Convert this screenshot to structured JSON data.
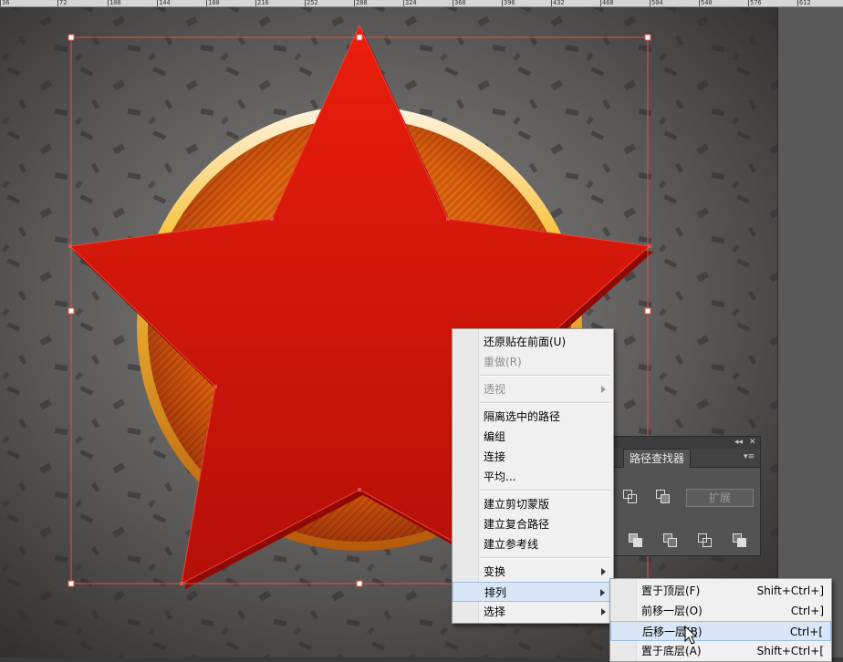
{
  "ruler": {
    "ticks": [
      "36",
      "72",
      "108",
      "144",
      "180",
      "216",
      "252",
      "288",
      "324",
      "360",
      "396",
      "432",
      "468",
      "504",
      "540",
      "576",
      "612"
    ]
  },
  "colors": {
    "canvas_bg": "#5a5a5a",
    "star_red": "#d81a0c",
    "selection": "#e0524a",
    "menu_bg": "#f0f0f0"
  },
  "context_menu": {
    "items": [
      {
        "label": "还原贴在前面(U)",
        "disabled": false
      },
      {
        "label": "重做(R)",
        "disabled": true
      },
      {
        "label": "透视",
        "disabled": true,
        "submenu": true
      },
      {
        "label": "隔离选中的路径"
      },
      {
        "label": "编组"
      },
      {
        "label": "连接"
      },
      {
        "label": "平均..."
      },
      {
        "label": "建立剪切蒙版"
      },
      {
        "label": "建立复合路径"
      },
      {
        "label": "建立参考线"
      },
      {
        "label": "变换",
        "submenu": true
      },
      {
        "label": "排列",
        "submenu": true,
        "active": true
      },
      {
        "label": "选择",
        "submenu": true
      }
    ]
  },
  "arrange_submenu": {
    "items": [
      {
        "label": "置于顶层(F)",
        "shortcut": "Shift+Ctrl+]"
      },
      {
        "label": "前移一层(O)",
        "shortcut": "Ctrl+]"
      },
      {
        "label": "后移一层(B)",
        "shortcut": "Ctrl+[",
        "hovered": true
      },
      {
        "label": "置于底层(A)",
        "shortcut": "Shift+Ctrl+["
      }
    ]
  },
  "pathfinder_panel": {
    "title": "路径查找器",
    "collapse_glyph": "◂◂",
    "close_glyph": "✕",
    "expand_label": "扩展"
  }
}
